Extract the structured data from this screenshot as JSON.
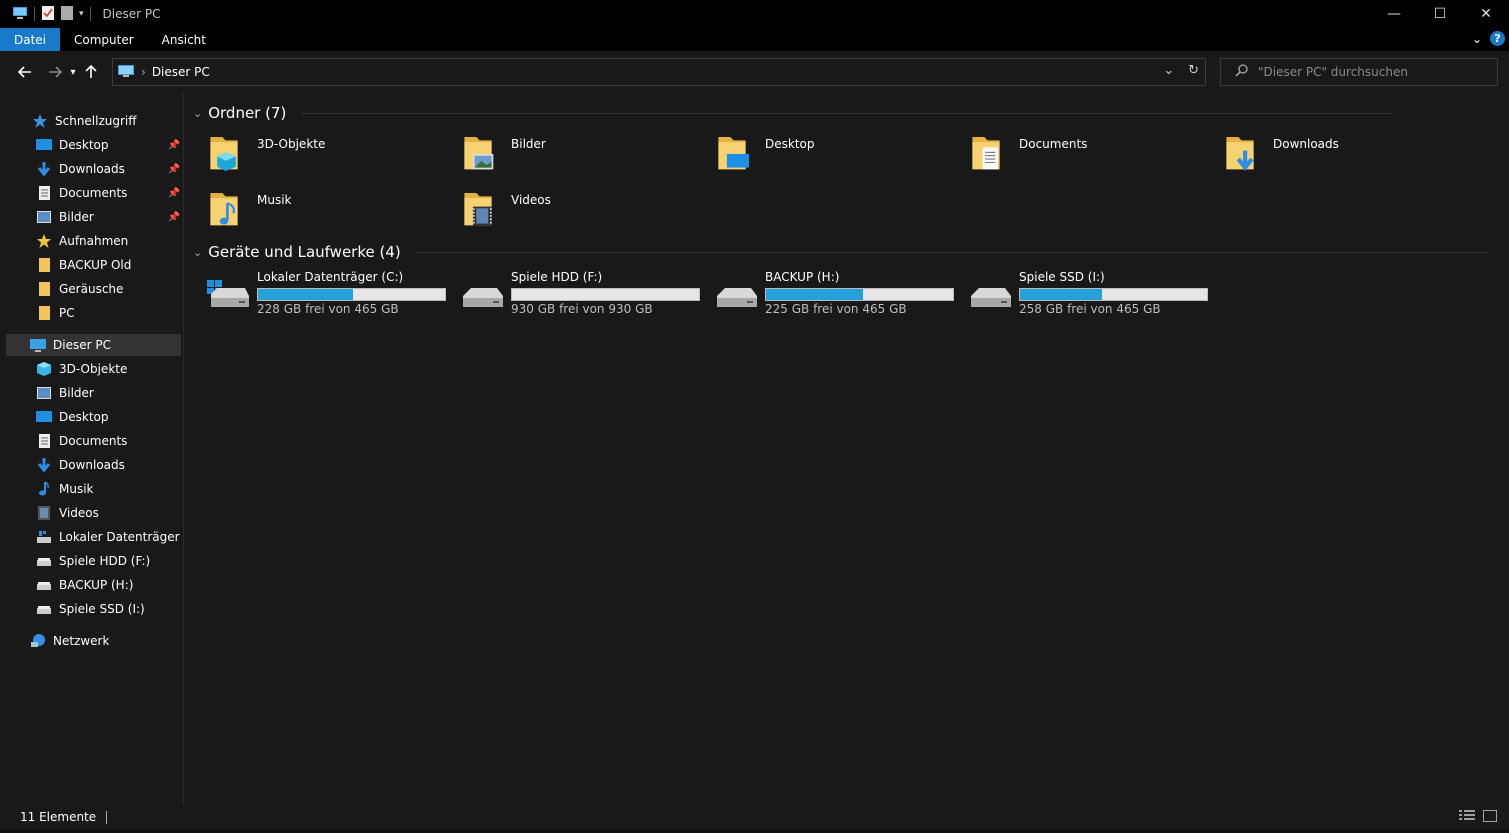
{
  "window": {
    "title": "Dieser PC",
    "minimize": "—",
    "maximize": "☐",
    "close": "✕"
  },
  "ribbon": {
    "tabs": [
      "Datei",
      "Computer",
      "Ansicht"
    ],
    "help": "?"
  },
  "address": {
    "path": "Dieser PC"
  },
  "search": {
    "placeholder": "\"Dieser PC\" durchsuchen"
  },
  "sidebar": {
    "quick_access": "Schnellzugriff",
    "quick_items": [
      "Desktop",
      "Downloads",
      "Documents",
      "Bilder",
      "Aufnahmen",
      "BACKUP Old",
      "Geräusche",
      "PC"
    ],
    "this_pc": "Dieser PC",
    "pc_items": [
      "3D-Objekte",
      "Bilder",
      "Desktop",
      "Documents",
      "Downloads",
      "Musik",
      "Videos",
      "Lokaler Datenträger (C:)",
      "Spiele HDD (F:)",
      "BACKUP (H:)",
      "Spiele SSD (I:)"
    ],
    "network": "Netzwerk"
  },
  "main": {
    "folders_header": "Ordner (7)",
    "folders": [
      "3D-Objekte",
      "Bilder",
      "Desktop",
      "Documents",
      "Downloads",
      "Musik",
      "Videos"
    ],
    "drives_header": "Geräte und Laufwerke (4)",
    "drives": [
      {
        "name": "Lokaler Datenträger (C:)",
        "free": "228 GB frei von 465 GB",
        "used_fraction": 0.51
      },
      {
        "name": "Spiele HDD (F:)",
        "free": "930 GB frei von 930 GB",
        "used_fraction": 0.0
      },
      {
        "name": "BACKUP (H:)",
        "free": "225 GB frei von 465 GB",
        "used_fraction": 0.52
      },
      {
        "name": "Spiele SSD (I:)",
        "free": "258 GB frei von 465 GB",
        "used_fraction": 0.44
      }
    ]
  },
  "status": {
    "count": "11 Elemente"
  },
  "colors": {
    "accent": "#1979ca",
    "bar_fill": "#26a0da",
    "folder": "#f2c55c"
  }
}
